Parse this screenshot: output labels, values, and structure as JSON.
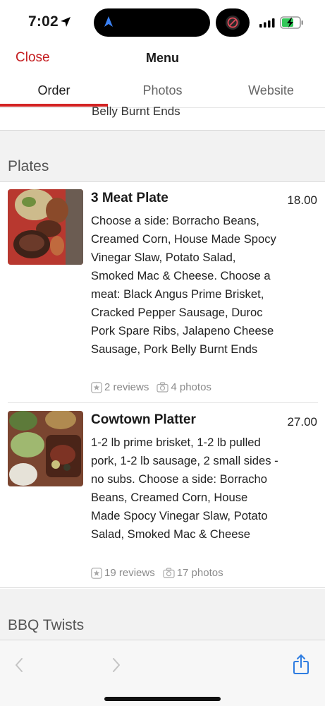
{
  "status": {
    "time": "7:02"
  },
  "header": {
    "close_label": "Close",
    "title": "Menu"
  },
  "tabs": [
    {
      "label": "Order",
      "active": true
    },
    {
      "label": "Photos",
      "active": false
    },
    {
      "label": "Website",
      "active": false
    }
  ],
  "previous_item_tail": "Belly Burnt Ends",
  "sections": [
    {
      "title": "Plates",
      "items": [
        {
          "name": "3 Meat Plate",
          "price": "18.00",
          "description": "Choose a side: Borracho Beans, Creamed Corn, House Made Spocy Vinegar Slaw, Potato Salad, Smoked Mac & Cheese. Choose a meat: Black Angus Prime Brisket, Cracked Pepper Sausage, Duroc Pork Spare Ribs, Jalapeno Cheese Sausage, Pork Belly Burnt Ends",
          "reviews": "2 reviews",
          "photos": "4 photos"
        },
        {
          "name": "Cowtown Platter",
          "price": "27.00",
          "description": "1-2 lb prime brisket, 1-2 lb pulled pork, 1-2 lb sausage, 2 small sides - no subs. Choose a side: Borracho Beans, Creamed Corn, House Made Spocy Vinegar Slaw, Potato Salad, Smoked Mac & Cheese",
          "reviews": "19 reviews",
          "photos": "17 photos"
        }
      ]
    },
    {
      "title": "BBQ Twists"
    }
  ],
  "colors": {
    "accent": "#d32323",
    "close_text": "#c41d20",
    "toolbar_icon": "#2f7de1"
  },
  "icons": [
    "location-arrow-icon",
    "navigation-icon",
    "no-symbol-icon",
    "signal-icon",
    "battery-charging-icon",
    "star-icon",
    "camera-icon",
    "back-icon",
    "forward-icon",
    "share-icon"
  ]
}
